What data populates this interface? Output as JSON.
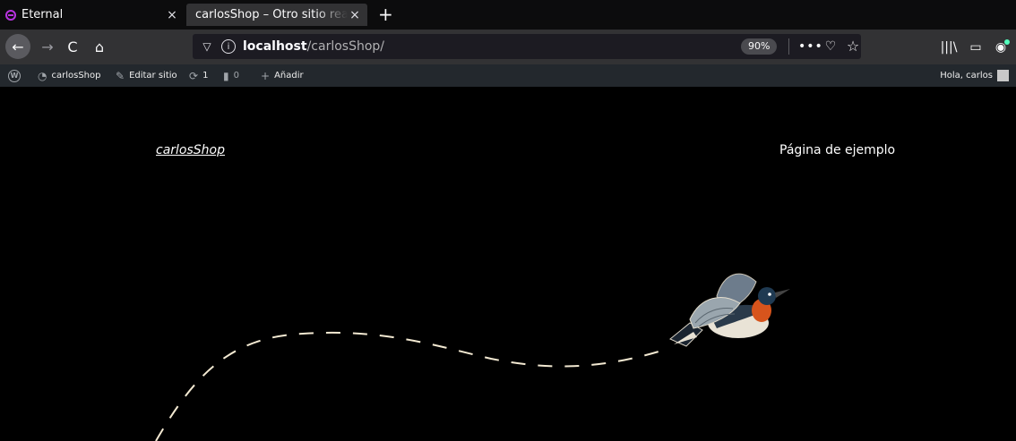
{
  "tabs": [
    {
      "title": "Eternal",
      "close": "×"
    },
    {
      "title": "carlosShop – Otro sitio realiz",
      "close": "×"
    }
  ],
  "new_tab": "+",
  "nav": {
    "url_host": "localhost",
    "url_path": "/carlosShop/",
    "zoom": "90%"
  },
  "icons": {
    "back": "←",
    "forward": "→",
    "reload": "C",
    "home": "⌂",
    "shield": "▽",
    "info": "i",
    "more": "•••",
    "pocket": "♡",
    "star": "☆",
    "library": "|||\\",
    "sidebar": "▭",
    "account": "◉"
  },
  "adminbar": {
    "wp_logo": "W",
    "site_name": "carlosShop",
    "edit_site": "Editar sitio",
    "updates_count": "1",
    "comments_count": "0",
    "new_label": "Añadir",
    "greeting": "Hola, carlos"
  },
  "site": {
    "title": "carlosShop",
    "nav_link": "Página de ejemplo"
  },
  "colors": {
    "page_background": "#000000",
    "path_stroke": "#f3e9d2",
    "admin_bar": "#23282d"
  }
}
